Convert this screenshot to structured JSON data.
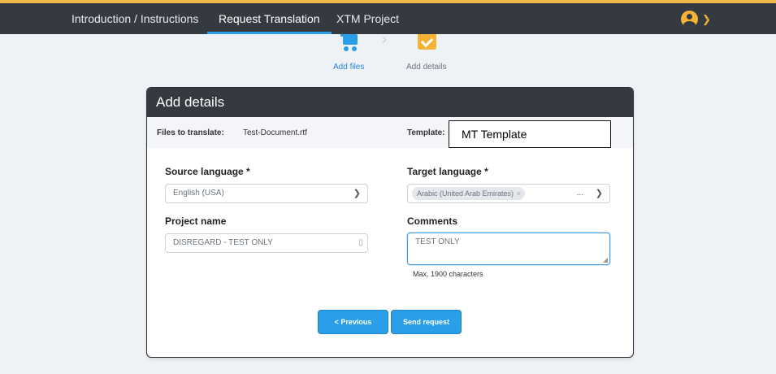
{
  "nav": {
    "tabs": [
      "Introduction / Instructions",
      "Request Translation",
      "XTM Project"
    ],
    "active_tab": "Request Translation",
    "user_menu_icon": "user-avatar-icon",
    "user_menu_chevron": "chevron-down-icon"
  },
  "steps": [
    {
      "label": "Add files",
      "icon": "cart-icon",
      "state": "previous"
    },
    {
      "label": "Add details",
      "icon": "checkbox-icon",
      "state": "current"
    }
  ],
  "card": {
    "title": "Add details",
    "files_label": "Files to translate:",
    "files_value": "Test-Document.rtf",
    "template_label": "Template:",
    "template_value": "MT Template"
  },
  "form": {
    "source_language_label": "Source language *",
    "source_language_value": "English (USA)",
    "target_language_label": "Target language *",
    "target_language_tag": "Arabic (United Arab Emirates)",
    "target_language_more": "...",
    "project_name_label": "Project name",
    "project_name_value": "DISREGARD - TEST ONLY",
    "comments_label": "Comments",
    "comments_value": "TEST ONLY",
    "comments_hint": "Max. 1900 characters"
  },
  "buttons": {
    "previous": "< Previous",
    "send": "Send request"
  },
  "colors": {
    "navbar": "#343a40",
    "accent_blue": "#2a9ee8",
    "accent_orange": "#f5b335",
    "background": "#eef1f5"
  }
}
